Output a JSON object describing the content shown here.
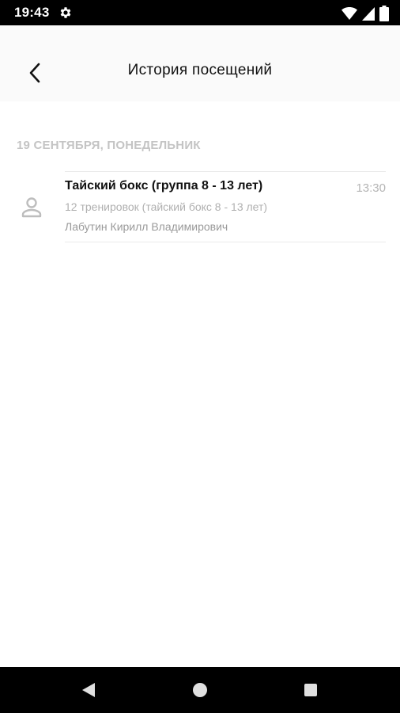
{
  "status_bar": {
    "time": "19:43",
    "icons": [
      "gear-icon",
      "wifi-icon",
      "signal-icon",
      "battery-icon"
    ]
  },
  "header": {
    "title": "История посещений",
    "back_icon": "chevron-left-icon"
  },
  "visits": {
    "date_header": "19 СЕНТЯБРЯ, ПОНЕДЕЛЬНИК",
    "items": [
      {
        "title": "Тайский бокс (группа 8 - 13 лет)",
        "time": "13:30",
        "subscription": "12 тренировок (тайский бокс 8 - 13 лет)",
        "trainer": "Лабутин Кирилл Владимирович",
        "icon": "person-icon"
      }
    ]
  },
  "nav_bar": {
    "buttons": [
      "back-triangle-icon",
      "home-circle-icon",
      "recents-square-icon"
    ]
  },
  "colors": {
    "status_bar": "#000000",
    "appbar_bg": "#fafafa",
    "section_header": "#c4c4c4",
    "text_primary": "#111111",
    "text_secondary": "#b0b0b0"
  }
}
